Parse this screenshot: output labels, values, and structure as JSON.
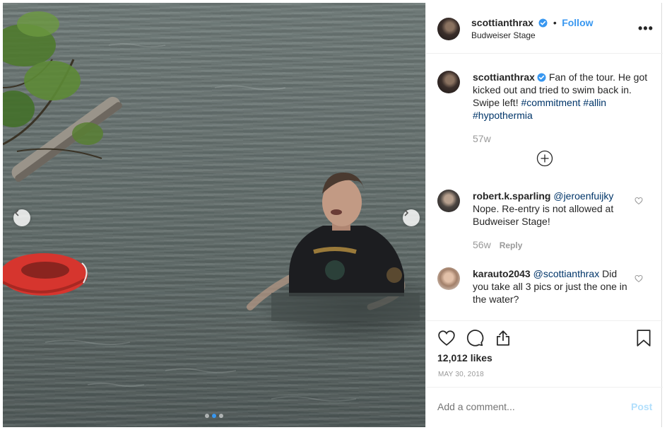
{
  "header": {
    "username": "scottianthrax",
    "follow_label": "Follow",
    "separator": "•",
    "location": "Budweiser Stage",
    "more_label": "•••"
  },
  "caption": {
    "username": "scottianthrax",
    "text": "Fan of the tour. He got kicked out and tried to swim back in. Swipe left! ",
    "hashtags": [
      "#commitment",
      "#allin",
      "#hypothermia"
    ],
    "age": "57w"
  },
  "comments": [
    {
      "username": "robert.k.sparling",
      "mention": "@jeroenfuijky",
      "text": "Nope. Re-entry is not allowed at Budweiser Stage!",
      "age": "56w",
      "reply_label": "Reply"
    },
    {
      "username": "karauto2043",
      "mention": "@scottianthrax",
      "text": "Did you take all 3 pics or just the one in the water?"
    }
  ],
  "post": {
    "likes": "12,012 likes",
    "date": "MAY 30, 2018"
  },
  "comment_input": {
    "placeholder": "Add a comment...",
    "post_label": "Post"
  },
  "carousel": {
    "slide_count": 3,
    "active_index": 1
  },
  "icons": [
    "chevron-left-icon",
    "chevron-right-icon",
    "verified-icon",
    "heart-icon",
    "comment-icon",
    "share-icon",
    "bookmark-icon",
    "load-more-icon"
  ],
  "colors": {
    "link": "#3897f0",
    "hashtag": "#003569",
    "muted": "#999999",
    "post_disabled": "#b2dffc"
  }
}
